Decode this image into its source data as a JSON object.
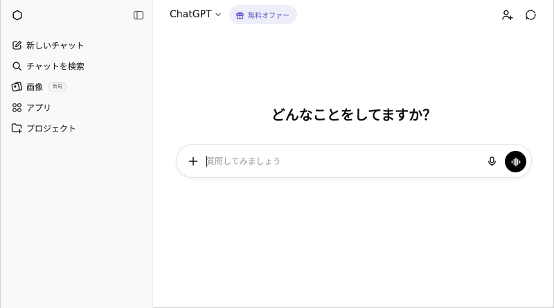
{
  "sidebar": {
    "logo_icon": "openai-logo-icon",
    "toggle_icon": "sidebar-toggle-icon",
    "items": [
      {
        "label": "新しいチャット",
        "icon": "edit-icon"
      },
      {
        "label": "チャットを検索",
        "icon": "search-icon"
      },
      {
        "label": "画像",
        "icon": "images-icon",
        "badge": "新規"
      },
      {
        "label": "アプリ",
        "icon": "apps-grid-icon"
      },
      {
        "label": "プロジェクト",
        "icon": "folder-plus-icon"
      }
    ]
  },
  "header": {
    "model": "ChatGPT",
    "offer_label": "無料オファー",
    "add_user_icon": "add-user-icon",
    "temporary_chat_icon": "temporary-chat-icon"
  },
  "main": {
    "heading": "どんなことをしてますか？",
    "composer": {
      "placeholder": "質問してみましょう",
      "value": ""
    }
  },
  "colors": {
    "sidebar_bg": "#f9f9f9",
    "offer_bg": "#eeeefb",
    "offer_text": "#5a52c8",
    "voice_button": "#000000"
  }
}
